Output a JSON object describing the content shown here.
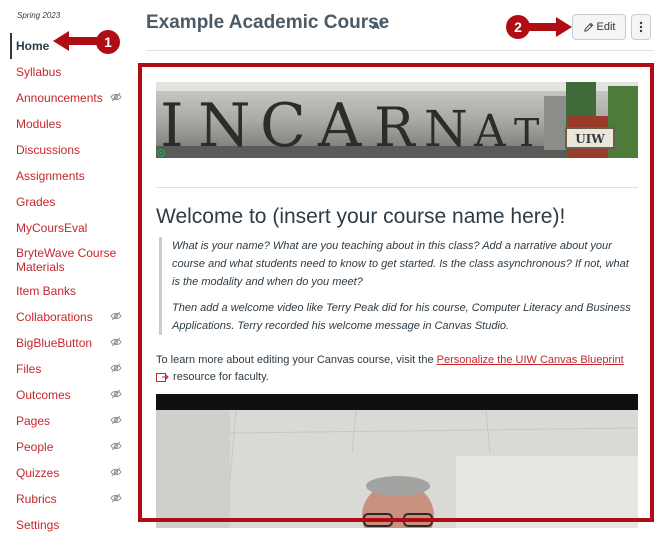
{
  "sidebar": {
    "term": "Spring 2023",
    "items": [
      {
        "label": "Home",
        "hidden": false
      },
      {
        "label": "Syllabus",
        "hidden": false
      },
      {
        "label": "Announcements",
        "hidden": true
      },
      {
        "label": "Modules",
        "hidden": false
      },
      {
        "label": "Discussions",
        "hidden": false
      },
      {
        "label": "Assignments",
        "hidden": false
      },
      {
        "label": "Grades",
        "hidden": false
      },
      {
        "label": "MyCoursEval",
        "hidden": false
      },
      {
        "label": "BryteWave Course Materials",
        "hidden": false
      },
      {
        "label": "Item Banks",
        "hidden": false
      },
      {
        "label": "Collaborations",
        "hidden": true
      },
      {
        "label": "BigBlueButton",
        "hidden": true
      },
      {
        "label": "Files",
        "hidden": true
      },
      {
        "label": "Outcomes",
        "hidden": true
      },
      {
        "label": "Pages",
        "hidden": true
      },
      {
        "label": "People",
        "hidden": true
      },
      {
        "label": "Quizzes",
        "hidden": true
      },
      {
        "label": "Rubrics",
        "hidden": true
      },
      {
        "label": "Settings",
        "hidden": false
      }
    ]
  },
  "header": {
    "title": "Example Academic Course",
    "edit_label": "Edit"
  },
  "callouts": {
    "one": "1",
    "two": "2"
  },
  "banner": {
    "carved_text": "INCARNATE WORD",
    "sign_text": "UIW"
  },
  "content": {
    "heading": "Welcome to (insert your course name here)!",
    "quote_p1": "What is your name? What are you teaching about in this class? Add a narrative about your course and what students need to know to get started. Is the class asynchronous? If not, what is the modality and when do you meet?",
    "quote_p2": "Then add a welcome video like Terry Peak did for his course, Computer Literacy and Business Applications. Terry recorded his welcome message in Canvas Studio.",
    "body_prefix": "To learn more about editing your Canvas course, visit the ",
    "link_text": "Personalize the UIW Canvas Blueprint",
    "body_suffix": " resource for faculty."
  },
  "colors": {
    "accent": "#c5272d",
    "callout": "#b00c14",
    "text": "#2d3b45"
  },
  "icons": {
    "hidden_indicator": "eye-off-icon",
    "edit": "pencil-icon",
    "more": "kebab-icon",
    "external_link": "external-link-icon"
  }
}
